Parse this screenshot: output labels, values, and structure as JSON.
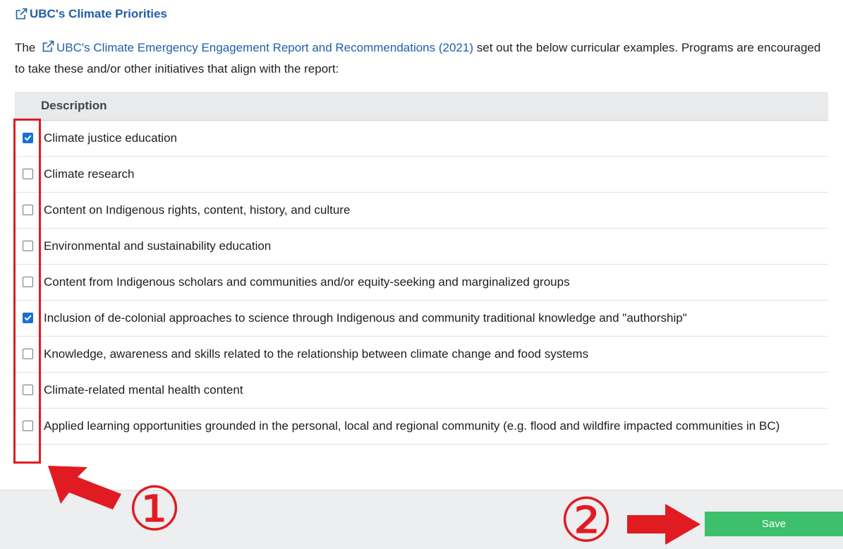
{
  "header": {
    "title": "UBC's Climate Priorities",
    "icon": "external-link-icon"
  },
  "intro": {
    "prefix": "The",
    "link_text": "UBC's Climate Emergency Engagement Report and Recommendations (2021)",
    "suffix": "set out the below curricular examples. Programs are encouraged to take these and/or other initiatives that align with the report:"
  },
  "table": {
    "column_header": "Description",
    "rows": [
      {
        "label": "Climate justice education",
        "checked": true
      },
      {
        "label": "Climate research",
        "checked": false
      },
      {
        "label": "Content on Indigenous rights, content, history, and culture",
        "checked": false
      },
      {
        "label": "Environmental and sustainability education",
        "checked": false
      },
      {
        "label": "Content from Indigenous scholars and communities and/or equity-seeking and marginalized groups",
        "checked": false
      },
      {
        "label": "Inclusion of de-colonial approaches to science through Indigenous and community traditional knowledge and \"authorship\"",
        "checked": true
      },
      {
        "label": "Knowledge, awareness and skills related to the relationship between climate change and food systems",
        "checked": false
      },
      {
        "label": "Climate-related mental health content",
        "checked": false
      },
      {
        "label": "Applied learning opportunities grounded in the personal, local and regional community (e.g. flood and wildfire impacted communities in BC)",
        "checked": false
      }
    ]
  },
  "footer": {
    "save_label": "Save"
  },
  "annotations": {
    "step1": "①",
    "step2": "②",
    "color": "#e11b22"
  },
  "colors": {
    "link": "#1f5fa8",
    "checkbox_checked": "#1a6fd6",
    "save_button": "#3cc06b"
  }
}
